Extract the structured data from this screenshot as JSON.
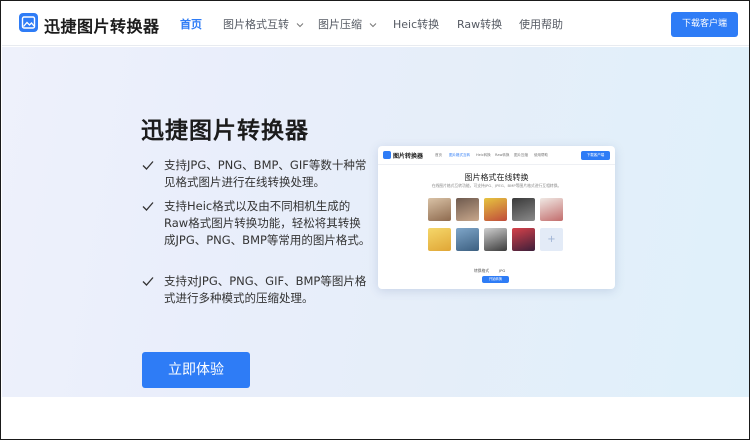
{
  "header": {
    "logo_text": "迅捷图片转换器",
    "nav": [
      {
        "label": "首页",
        "active": true
      },
      {
        "label": "图片格式互转",
        "dropdown": true
      },
      {
        "label": "图片压缩",
        "dropdown": true
      },
      {
        "label": "Heic转换"
      },
      {
        "label": "Raw转换"
      },
      {
        "label": "使用帮助"
      }
    ],
    "download_label": "下载客户端"
  },
  "hero": {
    "title": "迅捷图片转换器",
    "features": [
      "支持JPG、PNG、BMP、GIF等数十种常见格式图片进行在线转换处理。",
      "支持Heic格式以及由不同相机生成的Raw格式图片转换功能，轻松将其转换成JPG、PNG、BMP等常用的图片格式。",
      "支持对JPG、PNG、GIF、BMP等图片格式进行多种模式的压缩处理。"
    ],
    "cta_label": "立即体验"
  },
  "preview": {
    "logo_text": "图片转换器",
    "nav": [
      "首页",
      "图片格式互转",
      "Heic转换",
      "Raw转换",
      "图片压缩",
      "使用帮助"
    ],
    "download_label": "下载客户端",
    "title": "图片格式在线转换",
    "subtitle": "在线图片格式互转功能，可支持JPG、JPEG、BMP等图片格式进行互相转换。",
    "add_symbol": "+",
    "format_label": "转换格式",
    "format_value": "JPG",
    "convert_label": "开始转换"
  },
  "colors": {
    "accent": "#2e7cf6"
  }
}
